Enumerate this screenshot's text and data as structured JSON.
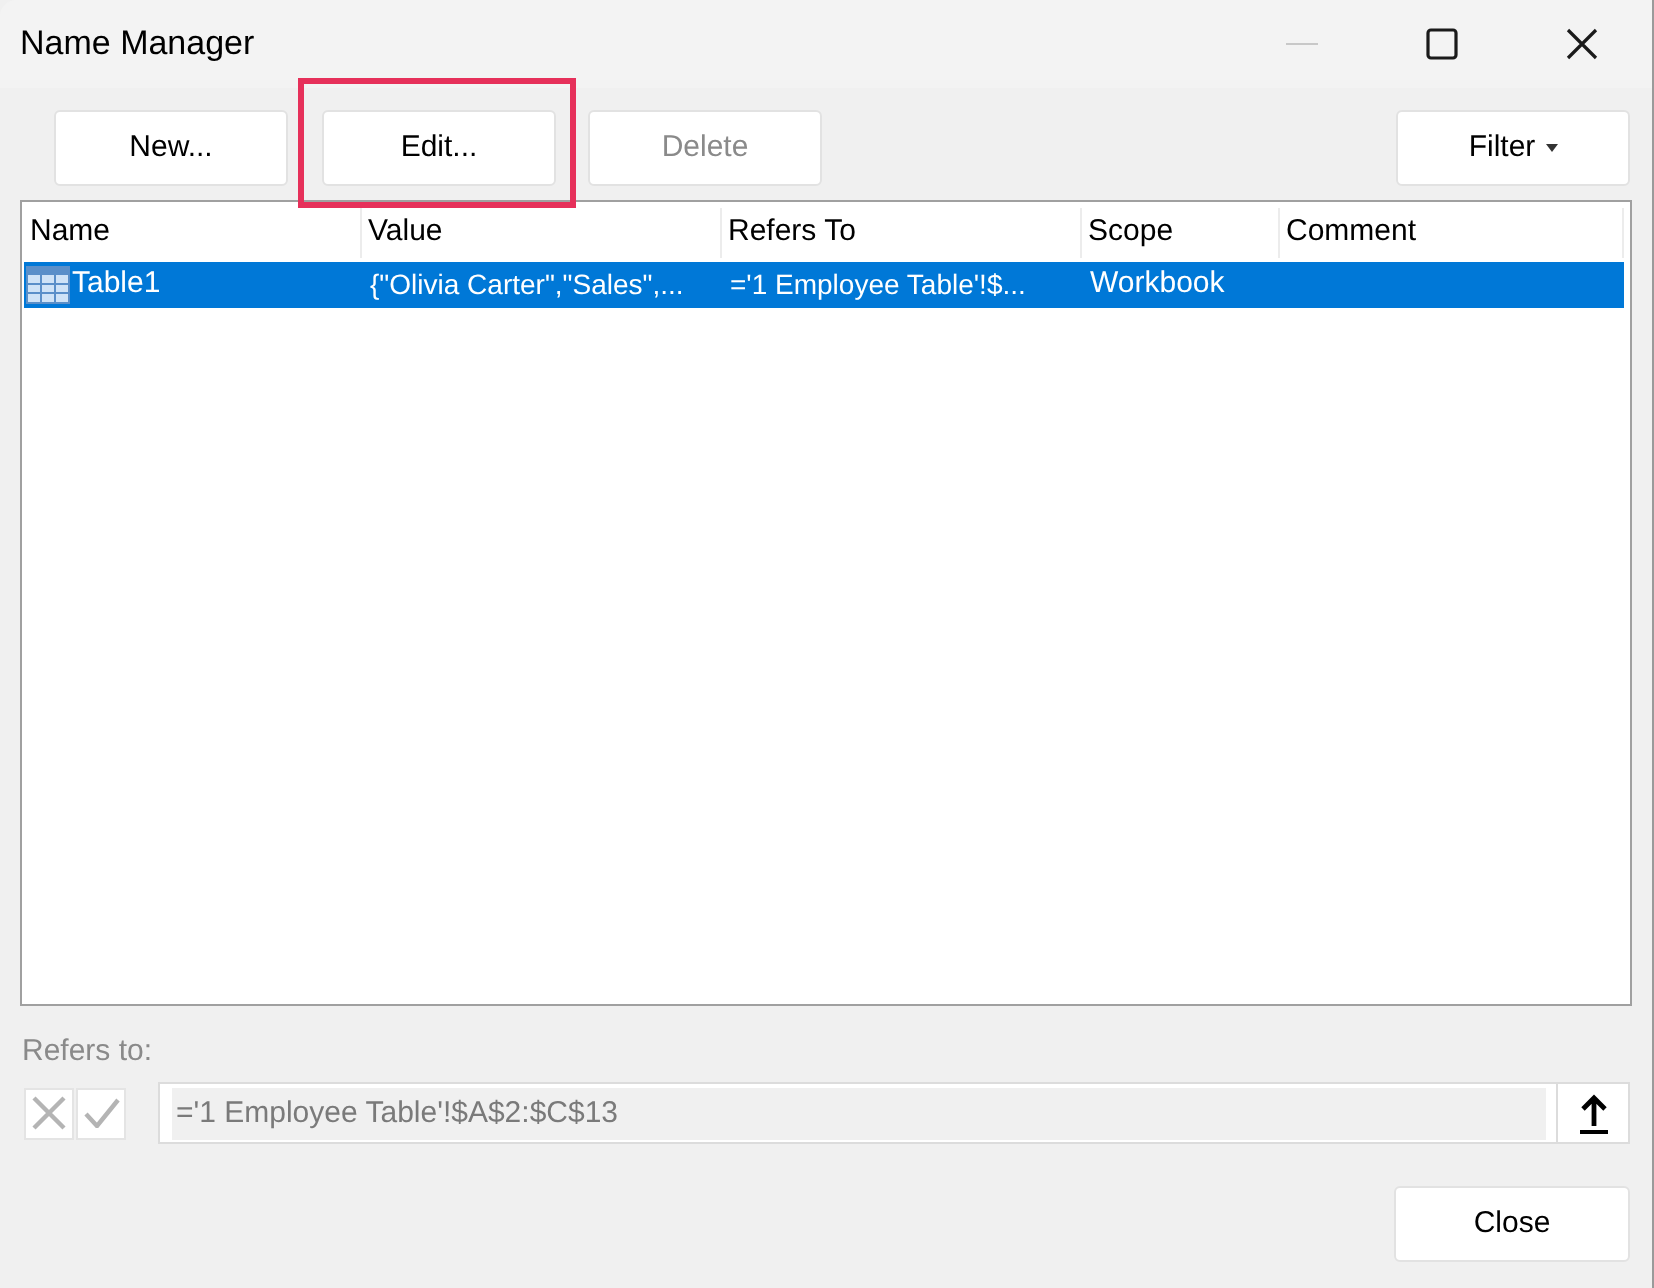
{
  "window": {
    "title": "Name Manager"
  },
  "toolbar": [
    {
      "label": "New...",
      "disabled": false,
      "highlighted": false
    },
    {
      "label": "Edit...",
      "disabled": false,
      "highlighted": true
    },
    {
      "label": "Delete",
      "disabled": true,
      "highlighted": false
    }
  ],
  "filter_button": {
    "label": "Filter"
  },
  "table": {
    "columns": [
      "Name",
      "Value",
      "Refers To",
      "Scope",
      "Comment"
    ],
    "rows": [
      {
        "selected": true,
        "name": "Table1",
        "value": "{\"Olivia Carter\",\"Sales\",...",
        "refers_to": "='1 Employee Table'!$...",
        "scope": "Workbook"
      }
    ]
  },
  "refers_to": {
    "label": "Refers to:",
    "value": "='1 Employee Table'!$A$2:$C$13",
    "edit_buttons_disabled": true
  },
  "close_button": {
    "label": "Close"
  }
}
